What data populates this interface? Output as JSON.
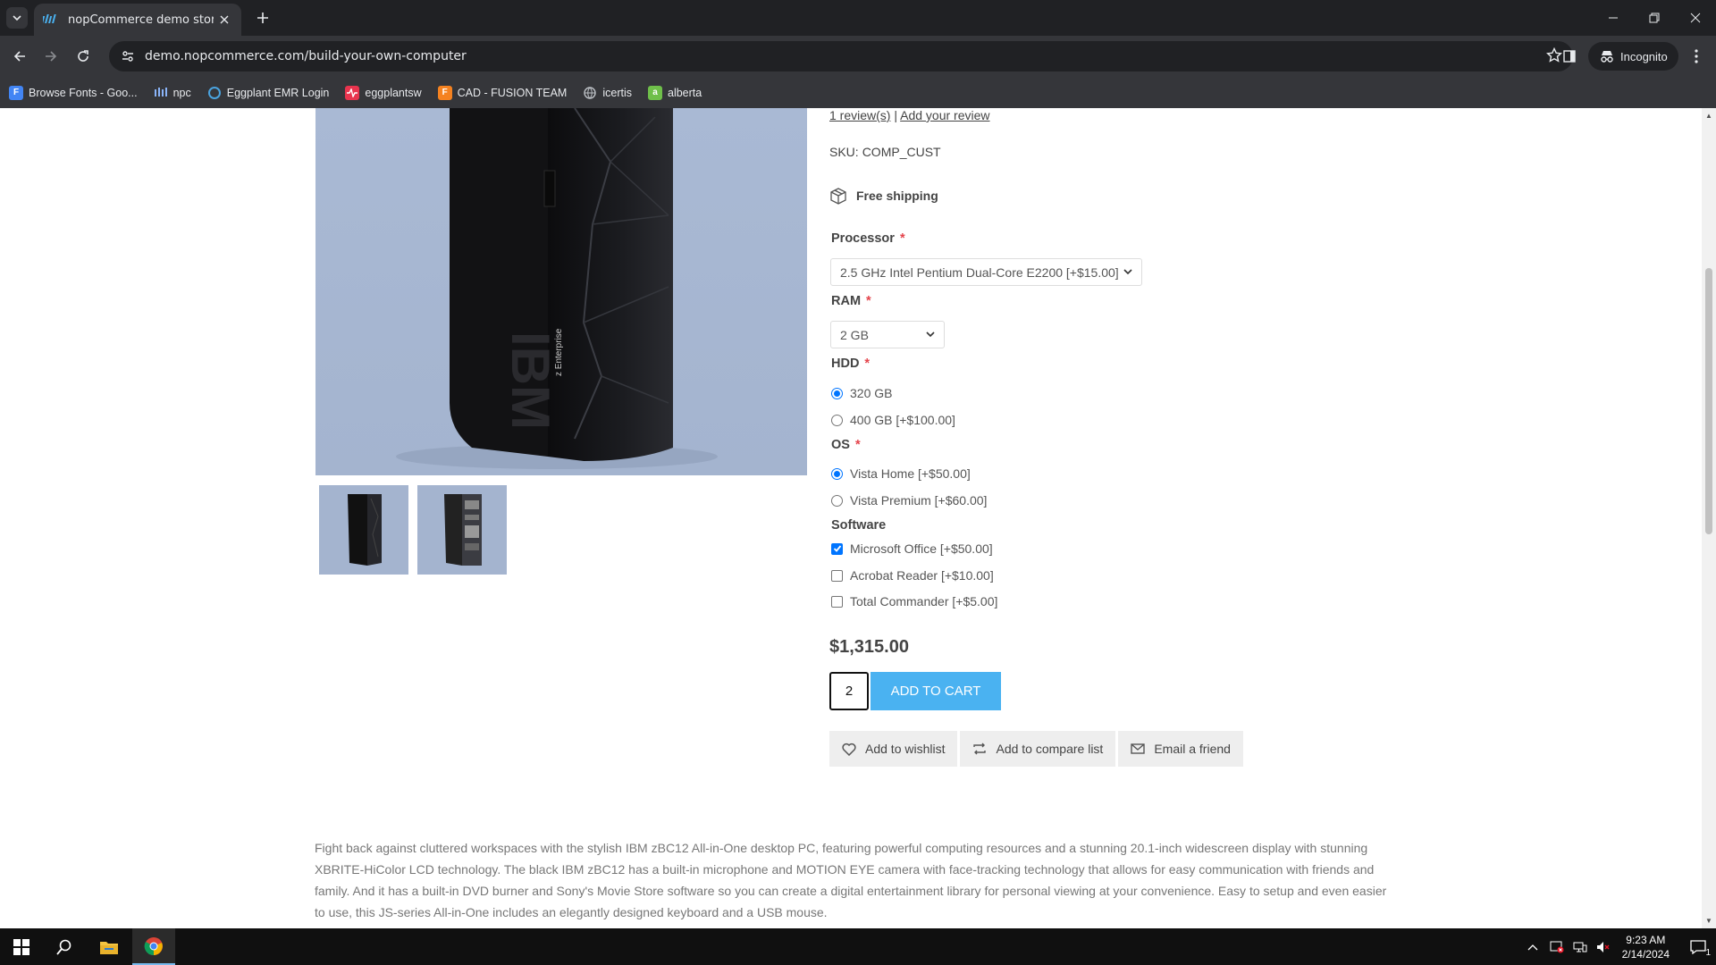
{
  "browser": {
    "tab_title": "nopCommerce demo store. Buil",
    "url": "demo.nopcommerce.com/build-your-own-computer",
    "incognito_label": "Incognito",
    "bookmarks": [
      {
        "label": "Browse Fonts - Goo...",
        "icon": "google-fonts-icon",
        "color": "#4285f4"
      },
      {
        "label": "npc",
        "icon": "grid-icon",
        "color": "#8ab4f8"
      },
      {
        "label": "Eggplant EMR Login",
        "icon": "eggplant-icon",
        "color": "#4aa3df"
      },
      {
        "label": "eggplantsw",
        "icon": "pulse-icon",
        "color": "#e8344e"
      },
      {
        "label": "CAD - FUSION TEAM",
        "icon": "fusion-icon",
        "color": "#f58220"
      },
      {
        "label": "icertis",
        "icon": "globe-icon",
        "color": "#bdc1c6"
      },
      {
        "label": "alberta",
        "icon": "alberta-icon",
        "color": "#6fbf4a"
      }
    ]
  },
  "product": {
    "reviews_link": "1 review(s)",
    "reviews_sep": "|",
    "add_review_link": "Add your review",
    "sku_label": "SKU:",
    "sku_value": "COMP_CUST",
    "shipping": "Free shipping",
    "processor": {
      "label": "Processor",
      "required": "*",
      "selected": "2.5 GHz Intel Pentium Dual-Core E2200 [+$15.00]"
    },
    "ram": {
      "label": "RAM",
      "required": "*",
      "selected": "2 GB"
    },
    "hdd": {
      "label": "HDD",
      "required": "*",
      "options": [
        {
          "label": "320 GB",
          "checked": true
        },
        {
          "label": "400 GB [+$100.00]",
          "checked": false
        }
      ]
    },
    "os": {
      "label": "OS",
      "required": "*",
      "options": [
        {
          "label": "Vista Home [+$50.00]",
          "checked": true
        },
        {
          "label": "Vista Premium [+$60.00]",
          "checked": false
        }
      ]
    },
    "software": {
      "label": "Software",
      "options": [
        {
          "label": "Microsoft Office [+$50.00]",
          "checked": true
        },
        {
          "label": "Acrobat Reader [+$10.00]",
          "checked": false
        },
        {
          "label": "Total Commander [+$5.00]",
          "checked": false
        }
      ]
    },
    "price": "$1,315.00",
    "quantity": "2",
    "add_to_cart": "ADD TO CART",
    "wishlist": "Add to wishlist",
    "compare": "Add to compare list",
    "email_friend": "Email a friend",
    "image_brand_text": "IBM",
    "image_side_text": "z Enterprise",
    "description": "Fight back against cluttered workspaces with the stylish IBM zBC12 All-in-One desktop PC, featuring powerful computing resources and a stunning 20.1-inch widescreen display with stunning XBRITE-HiColor LCD technology. The black IBM zBC12 has a built-in microphone and MOTION EYE camera with face-tracking technology that allows for easy communication with friends and family. And it has a built-in DVD burner and Sony's Movie Store software so you can create a digital entertainment library for personal viewing at your convenience. Easy to setup and even easier to use, this JS-series All-in-One includes an elegantly designed keyboard and a USB mouse."
  },
  "taskbar": {
    "time": "9:23 AM",
    "date": "2/14/2024",
    "notification_count": "1"
  },
  "colors": {
    "accent_button": "#4ab2f1",
    "required_star": "#e4434b",
    "check_blue": "#0075ff"
  }
}
